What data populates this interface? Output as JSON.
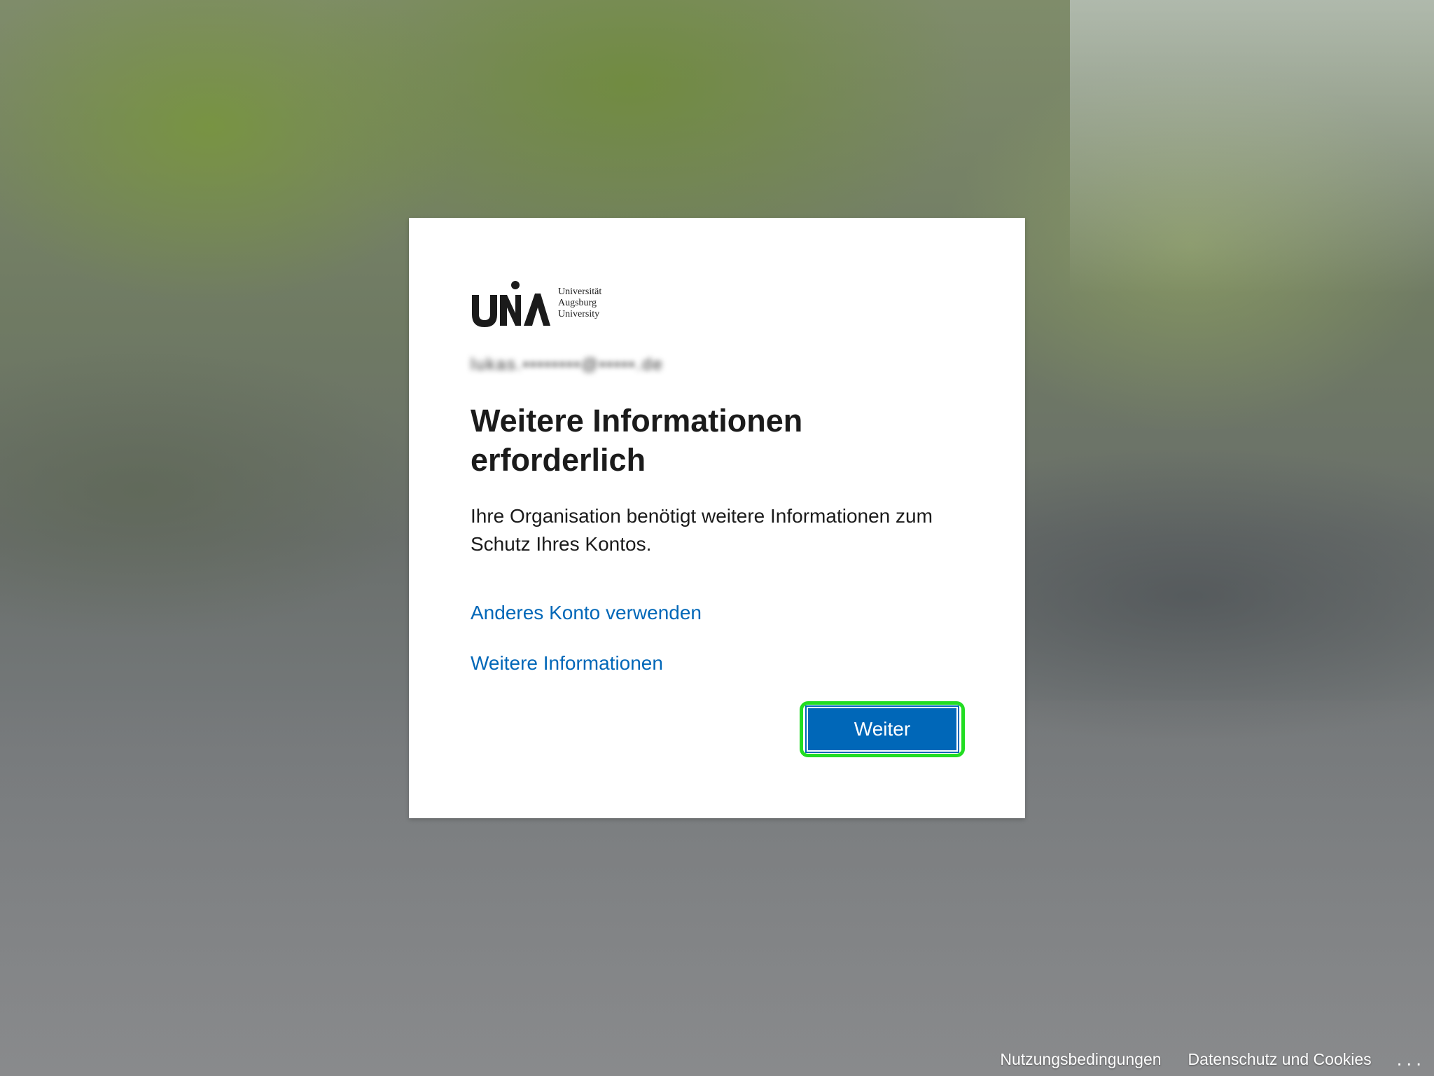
{
  "logo": {
    "mark": "UNiA",
    "line1": "Universität",
    "line2": "Augsburg",
    "line3": "University"
  },
  "account": {
    "email": "lukas.••••••••@•••••.de"
  },
  "main": {
    "title": "Weitere Informationen erforderlich",
    "description": "Ihre Organisation benötigt weitere Informationen zum Schutz Ihres Kontos.",
    "link_other_account": "Anderes Konto verwenden",
    "link_more_info": "Weitere Informationen",
    "next_button": "Weiter"
  },
  "footer": {
    "terms": "Nutzungsbedingungen",
    "privacy": "Datenschutz und Cookies",
    "more": "..."
  },
  "colors": {
    "accent": "#0067b8",
    "highlight": "#22dd22"
  }
}
